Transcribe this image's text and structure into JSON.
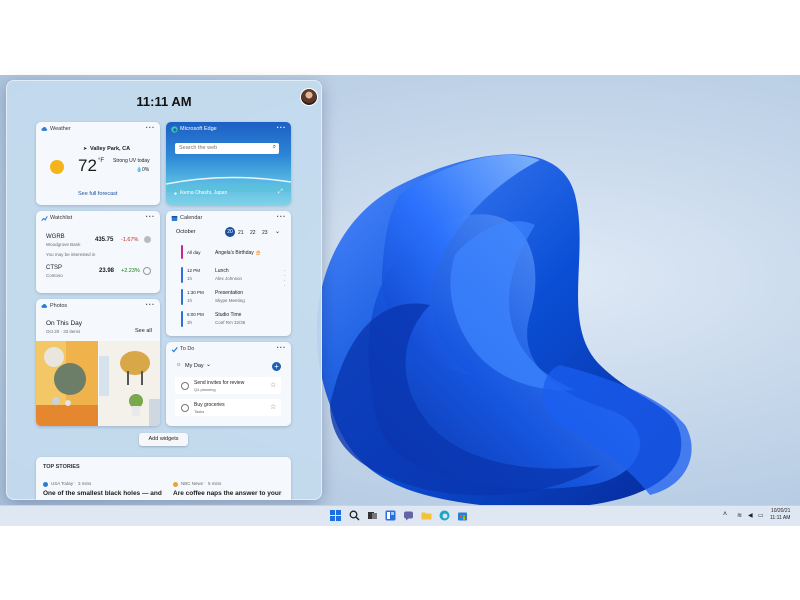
{
  "header": {
    "time": "11:11 AM"
  },
  "weather": {
    "title": "Weather",
    "location": "Valley Park, CA",
    "temp": "72",
    "unit": "°F",
    "condition": "Strong UV today",
    "precip": "0%",
    "link": "See full forecast"
  },
  "edge": {
    "title": "Microsoft Edge",
    "placeholder": "Search the web",
    "caption": "Ikema Ohashi, Japan"
  },
  "watchlist": {
    "title": "Watchlist",
    "stocks": [
      {
        "symbol": "WGRB",
        "company": "Woodgrove Bank",
        "price": "435.75",
        "change": "-1.67%"
      },
      {
        "symbol": "CTSP",
        "company": "Contoso",
        "price": "23.98",
        "change": "+2.23%"
      }
    ],
    "note": "You may be interested in"
  },
  "calendar": {
    "title": "Calendar",
    "month": "October",
    "dates": [
      "20",
      "21",
      "22",
      "23"
    ],
    "events": [
      {
        "time": "All day",
        "duration": "",
        "title": "Angela's Birthday 🎂",
        "subtitle": "",
        "color": "#c2288f"
      },
      {
        "time": "12 PM",
        "duration": "1h",
        "title": "Lunch",
        "subtitle": "Alex  Johnson",
        "color": "#2e6fd8"
      },
      {
        "time": "1:30 PM",
        "duration": "1h",
        "title": "Presentation",
        "subtitle": "Skype Meeting",
        "color": "#2e6fd8"
      },
      {
        "time": "6:00 PM",
        "duration": "3h",
        "title": "Studio Time",
        "subtitle": "Conf Rm 32/35",
        "color": "#2e6fd8"
      }
    ]
  },
  "photos": {
    "title": "Photos",
    "heading": "On This Day",
    "subheading": "Oct 20 · 33 items",
    "link": "See all"
  },
  "todo": {
    "title": "To Do",
    "list": "My Day",
    "tasks": [
      {
        "title": "Send invites for review",
        "subtitle": "Q4 planning"
      },
      {
        "title": "Buy groceries",
        "subtitle": "Tasks"
      }
    ]
  },
  "add_widgets": "Add widgets",
  "stories": {
    "heading": "TOP STORIES",
    "items": [
      {
        "source": "USA Today",
        "age": "3 mins",
        "headline": "One of the smallest black holes — and"
      },
      {
        "source": "NBC News",
        "age": "5 mins",
        "headline": "Are coffee naps the answer to your"
      }
    ]
  },
  "taskbar": {
    "time": "11:11 AM",
    "date": "10/20/21"
  },
  "colors": {
    "accent": "#0f6cbd",
    "negative": "#c42b1c",
    "positive": "#107c10",
    "wallpaper_bloom": "#0a4fd8"
  }
}
